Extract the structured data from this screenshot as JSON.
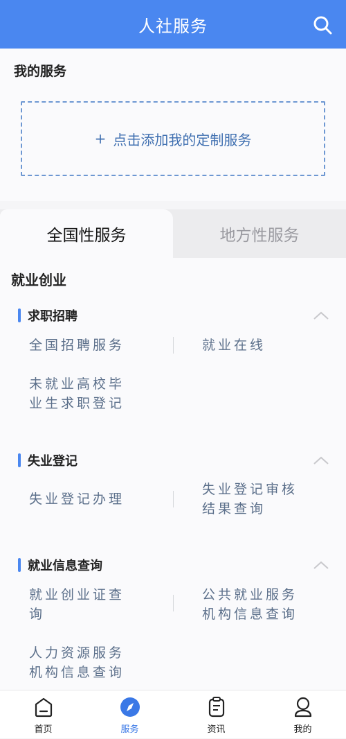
{
  "header": {
    "title": "人社服务"
  },
  "my_services": {
    "title": "我的服务",
    "add_plus": "+",
    "add_label": "点击添加我的定制服务"
  },
  "tabs": [
    {
      "label": "全国性服务",
      "active": true
    },
    {
      "label": "地方性服务",
      "active": false
    }
  ],
  "category": {
    "title": "就业创业"
  },
  "sections": [
    {
      "title": "求职招聘",
      "items": [
        {
          "line1": "全国招聘服务",
          "line2": ""
        },
        {
          "line1": "就业在线",
          "line2": ""
        },
        {
          "line1": "未就业高校毕",
          "line2": "业生求职登记"
        }
      ]
    },
    {
      "title": "失业登记",
      "items": [
        {
          "line1": "失业登记办理",
          "line2": ""
        },
        {
          "line1": "失业登记审核",
          "line2": "结果查询"
        }
      ]
    },
    {
      "title": "就业信息查询",
      "items": [
        {
          "line1": "就业创业证查",
          "line2": "询"
        },
        {
          "line1": "公共就业服务",
          "line2": "机构信息查询"
        },
        {
          "line1": "人力资源服务",
          "line2": "机构信息查询"
        }
      ]
    }
  ],
  "bottom_nav": [
    {
      "label": "首页",
      "icon": "home-icon",
      "active": false
    },
    {
      "label": "服务",
      "icon": "compass-icon",
      "active": true
    },
    {
      "label": "资讯",
      "icon": "news-icon",
      "active": false
    },
    {
      "label": "我的",
      "icon": "user-icon",
      "active": false
    }
  ],
  "colors": {
    "primary": "#4a87f0",
    "item_text": "#5b6f8a",
    "inactive_tab": "#9a9aa0"
  }
}
